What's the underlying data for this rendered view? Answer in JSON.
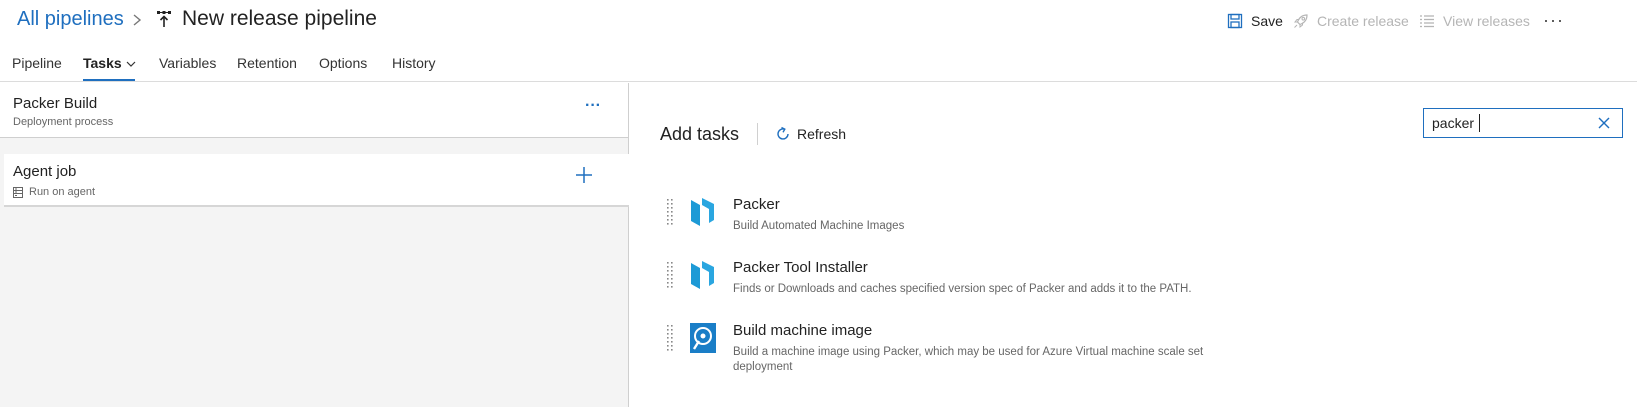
{
  "header": {
    "breadcrumb": "All pipelines",
    "title": "New release pipeline",
    "actions": {
      "save": "Save",
      "create_release": "Create release",
      "view_releases": "View releases",
      "more": "···"
    }
  },
  "tabs": [
    {
      "label": "Pipeline"
    },
    {
      "label": "Tasks"
    },
    {
      "label": "Variables"
    },
    {
      "label": "Retention"
    },
    {
      "label": "Options"
    },
    {
      "label": "History"
    }
  ],
  "active_tab": "Tasks",
  "stage": {
    "name": "Packer Build",
    "subtitle": "Deployment process",
    "more": "···"
  },
  "job": {
    "name": "Agent job",
    "subtitle": "Run on agent"
  },
  "add_tasks": {
    "title": "Add tasks",
    "refresh": "Refresh",
    "search_value": "packer"
  },
  "tasks": [
    {
      "name": "Packer",
      "description": "Build Automated Machine Images",
      "icon": "packer-icon"
    },
    {
      "name": "Packer Tool Installer",
      "description": "Finds or Downloads and caches specified version spec of Packer and adds it to the PATH.",
      "icon": "packer-icon"
    },
    {
      "name": "Build machine image",
      "description": "Build a machine image using Packer, which may be used for Azure Virtual machine scale set deployment",
      "icon": "machine-image-icon"
    }
  ],
  "colors": {
    "accent": "#1f6fbf",
    "packer": "#1d9ad6",
    "disabled": "#b5b5b5"
  }
}
